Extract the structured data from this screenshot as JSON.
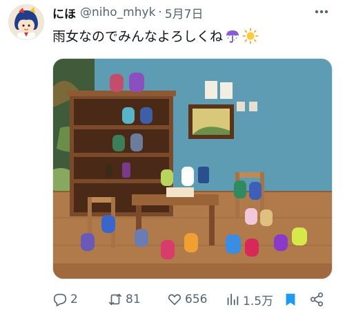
{
  "user": {
    "display_name": "にほ",
    "handle": "@niho_mhyk",
    "separator": "·",
    "date": "5月7日"
  },
  "tweet": {
    "text": "雨女なのでみんなよろしくね",
    "emoji": [
      "umbrella-with-rain-icon",
      "sun-icon"
    ]
  },
  "photo": {
    "subject": "figure-collection-diorama-photo"
  },
  "actions": {
    "replies": "2",
    "retweets": "81",
    "likes": "656",
    "views": "1.5万"
  },
  "colors": {
    "accent": "#1d9bf0",
    "text": "#0f1419",
    "secondary": "#536471",
    "wall": "#5d9cb2"
  }
}
